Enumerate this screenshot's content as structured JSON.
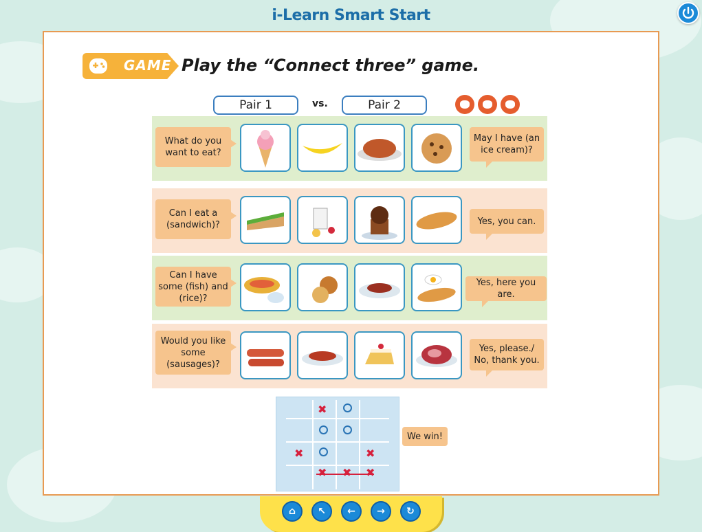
{
  "app": {
    "title": "i-Learn Smart Start"
  },
  "header": {
    "badge_label": "GAME",
    "instruction": "Play the “Connect three” game."
  },
  "pairs": {
    "left": "Pair 1",
    "vs": "vs.",
    "right": "Pair 2",
    "rps_icons": [
      "paper-hand-icon",
      "rock-hand-icon",
      "scissors-hand-icon"
    ]
  },
  "rows": [
    {
      "question": "What do you want to eat?",
      "answer": "May I have (an ice cream)?",
      "color": "green",
      "foods": [
        "ice-cream",
        "banana",
        "roast-chicken",
        "cookie"
      ]
    },
    {
      "question": "Can I eat a (sandwich)?",
      "answer": "Yes, you can.",
      "color": "peach",
      "foods": [
        "sandwich",
        "yogurt",
        "cupcake",
        "bread"
      ]
    },
    {
      "question": "Can I have some (fish) and (rice)?",
      "answer": "Yes, here you are.",
      "color": "green",
      "foods": [
        "fish-and-rice",
        "pancakes",
        "spaghetti",
        "eggs-and-bread"
      ]
    },
    {
      "question": "Would you like some (sausages)?",
      "answer": "Yes, please./ No, thank you.",
      "color": "peach",
      "foods": [
        "sausages",
        "pasta",
        "cake",
        "steak"
      ]
    }
  ],
  "example": {
    "speech": "We win!",
    "grid": [
      [
        "",
        "x",
        "o",
        ""
      ],
      [
        "",
        "o",
        "o",
        ""
      ],
      [
        "x",
        "o",
        "",
        "x"
      ],
      [
        "",
        "x",
        "x",
        "x"
      ]
    ]
  },
  "nav": {
    "buttons": [
      "home-icon",
      "up-arrow-icon",
      "back-arrow-icon",
      "forward-arrow-icon",
      "refresh-icon"
    ]
  },
  "colors": {
    "title": "#1c6ea8",
    "frame": "#e89a52",
    "badge": "#f6b23a",
    "button": "#1b8ad8",
    "tray": "#fee14a"
  }
}
